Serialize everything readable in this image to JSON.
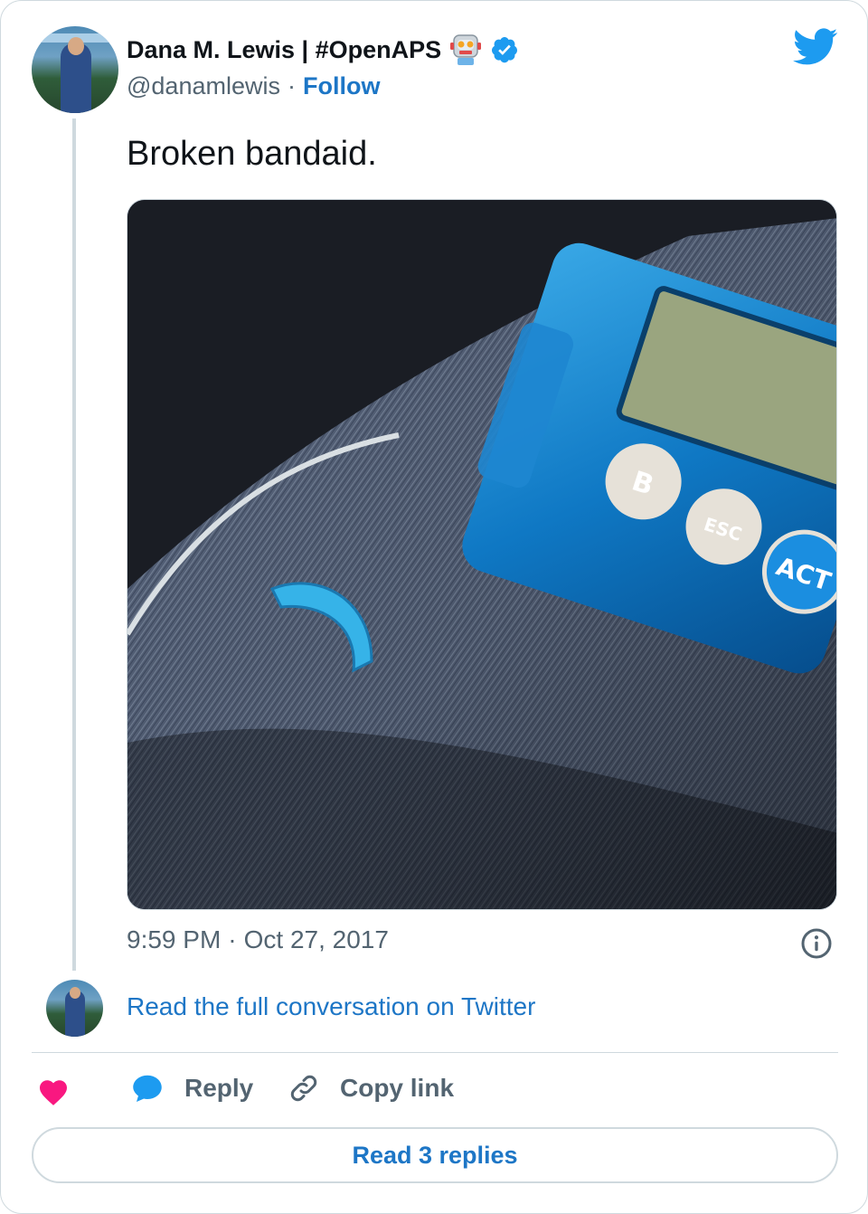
{
  "author": {
    "display_name": "Dana M. Lewis | #OpenAPS",
    "handle": "@danamlewis",
    "separator": "·",
    "follow_label": "Follow"
  },
  "tweet": {
    "text": "Broken bandaid.",
    "time": "9:59 PM",
    "separator": "·",
    "date": "Oct 27, 2017"
  },
  "photo": {
    "screen_button_left": "B",
    "screen_button_mid": "ESC",
    "screen_button_right": "ACT"
  },
  "conversation": {
    "read_full_label": "Read the full conversation on Twitter"
  },
  "actions": {
    "reply_label": "Reply",
    "copy_link_label": "Copy link",
    "read_replies_label": "Read 3 replies"
  },
  "colors": {
    "link_blue": "#1d76c6",
    "heart": "#f91880",
    "twitter_blue": "#1d9bf0",
    "secondary_text": "#536471"
  }
}
